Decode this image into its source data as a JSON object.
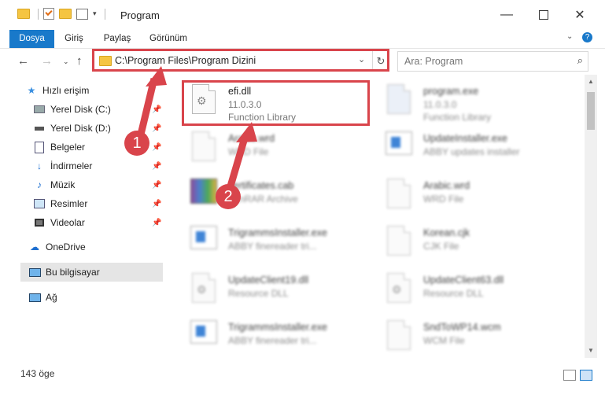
{
  "window": {
    "title": "Program"
  },
  "ribbon": {
    "tabs": [
      "Dosya",
      "Giriş",
      "Paylaş",
      "Görünüm"
    ]
  },
  "address": {
    "path": "C:\\Program Files\\Program Dizini"
  },
  "search": {
    "placeholder": "Ara: Program"
  },
  "sidebar": {
    "items": [
      {
        "label": "Hızlı erişim"
      },
      {
        "label": "Yerel Disk (C:)"
      },
      {
        "label": "Yerel Disk (D:)"
      },
      {
        "label": "Belgeler"
      },
      {
        "label": "İndirmeler"
      },
      {
        "label": "Müzik"
      },
      {
        "label": "Resimler"
      },
      {
        "label": "Videolar"
      },
      {
        "label": "OneDrive"
      },
      {
        "label": "Bu bilgisayar"
      },
      {
        "label": "Ağ"
      }
    ]
  },
  "files": [
    {
      "name": "efi.dll",
      "line2": "11.0.3.0",
      "line3": "Function Library"
    },
    {
      "name": "program.exe",
      "line2": "11.0.3.0",
      "line3": "Function Library"
    },
    {
      "name": "Arabic.wrd",
      "line2": "WRD File",
      "line3": ""
    },
    {
      "name": "UpdateInstaller.exe",
      "line2": "ABBY updates installer",
      "line3": ""
    },
    {
      "name": "certificates.cab",
      "line2": "WinRAR Archive",
      "line3": ""
    },
    {
      "name": "Arabic.wrd",
      "line2": "WRD File",
      "line3": ""
    },
    {
      "name": "TrigrammsInstaller.exe",
      "line2": "ABBY finereader tri...",
      "line3": ""
    },
    {
      "name": "Korean.cjk",
      "line2": "CJK File",
      "line3": ""
    },
    {
      "name": "UpdateClient19.dll",
      "line2": "Resource DLL",
      "line3": ""
    },
    {
      "name": "UpdateClient63.dll",
      "line2": "Resource DLL",
      "line3": ""
    },
    {
      "name": "TrigrammsInstaller.exe",
      "line2": "ABBY finereader tri...",
      "line3": ""
    },
    {
      "name": "SndToWP14.wcm",
      "line2": "WCM File",
      "line3": ""
    }
  ],
  "status": {
    "count": "143 öge"
  },
  "annotations": {
    "badge1": "1",
    "badge2": "2"
  },
  "colors": {
    "accent": "#1979ca",
    "highlight": "#d9444b"
  }
}
